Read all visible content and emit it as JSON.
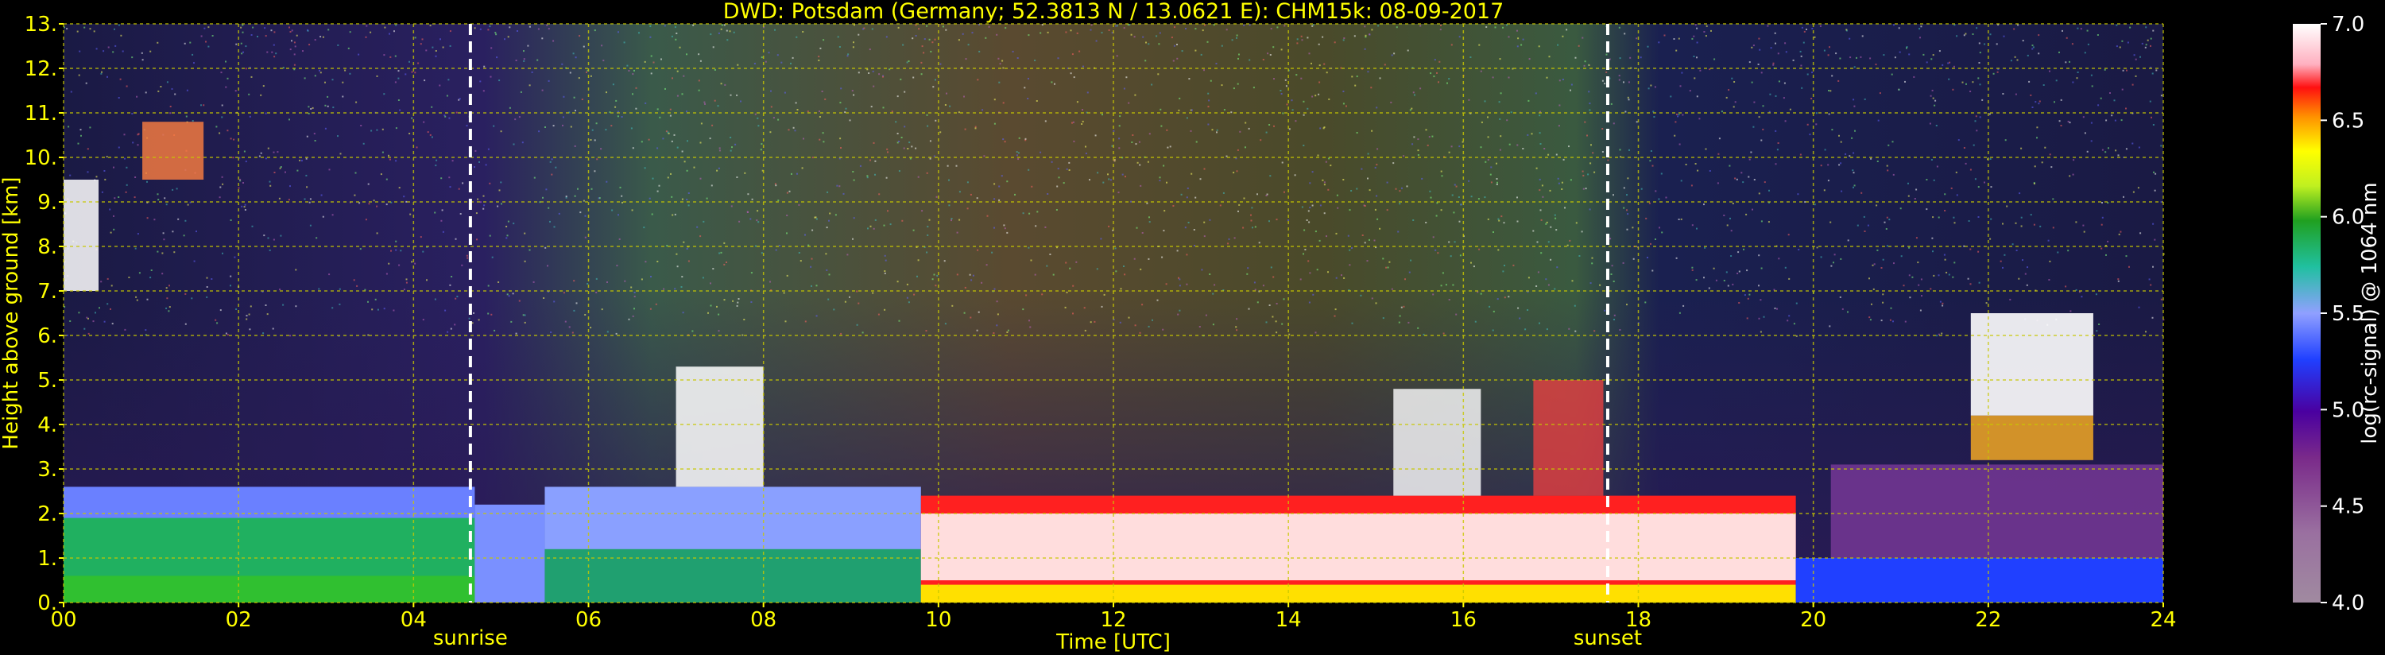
{
  "chart_data": {
    "type": "heatmap",
    "title": "DWD: Potsdam (Germany; 52.3813 N / 13.0621 E):    CHM15k: 08-09-2017",
    "xlabel": "Time [UTC]",
    "ylabel": "Height above ground [km]",
    "xlim": [
      0,
      24
    ],
    "ylim": [
      0,
      13
    ],
    "x_ticks": [
      "00",
      "02",
      "04",
      "06",
      "08",
      "10",
      "12",
      "14",
      "16",
      "18",
      "20",
      "22",
      "24"
    ],
    "y_ticks": [
      "0.",
      "1.",
      "2.",
      "3.",
      "4.",
      "5.",
      "6.",
      "7.",
      "8.",
      "9.",
      "10.",
      "11.",
      "12.",
      "13."
    ],
    "grid": true,
    "annotations": [
      {
        "text": "sunrise",
        "x": 4.65
      },
      {
        "text": "sunset",
        "x": 17.65
      }
    ],
    "colorbar": {
      "label": "log(rc-signal) @ 1064 nm",
      "range": [
        4.0,
        7.0
      ],
      "ticks": [
        "4.0",
        "4.5",
        "5.0",
        "5.5",
        "6.0",
        "6.5",
        "7.0"
      ]
    },
    "colors": {
      "background": "#000000",
      "text": "#ffff00",
      "grid": "#c8c800",
      "sun_lines": "#ffffff"
    }
  }
}
